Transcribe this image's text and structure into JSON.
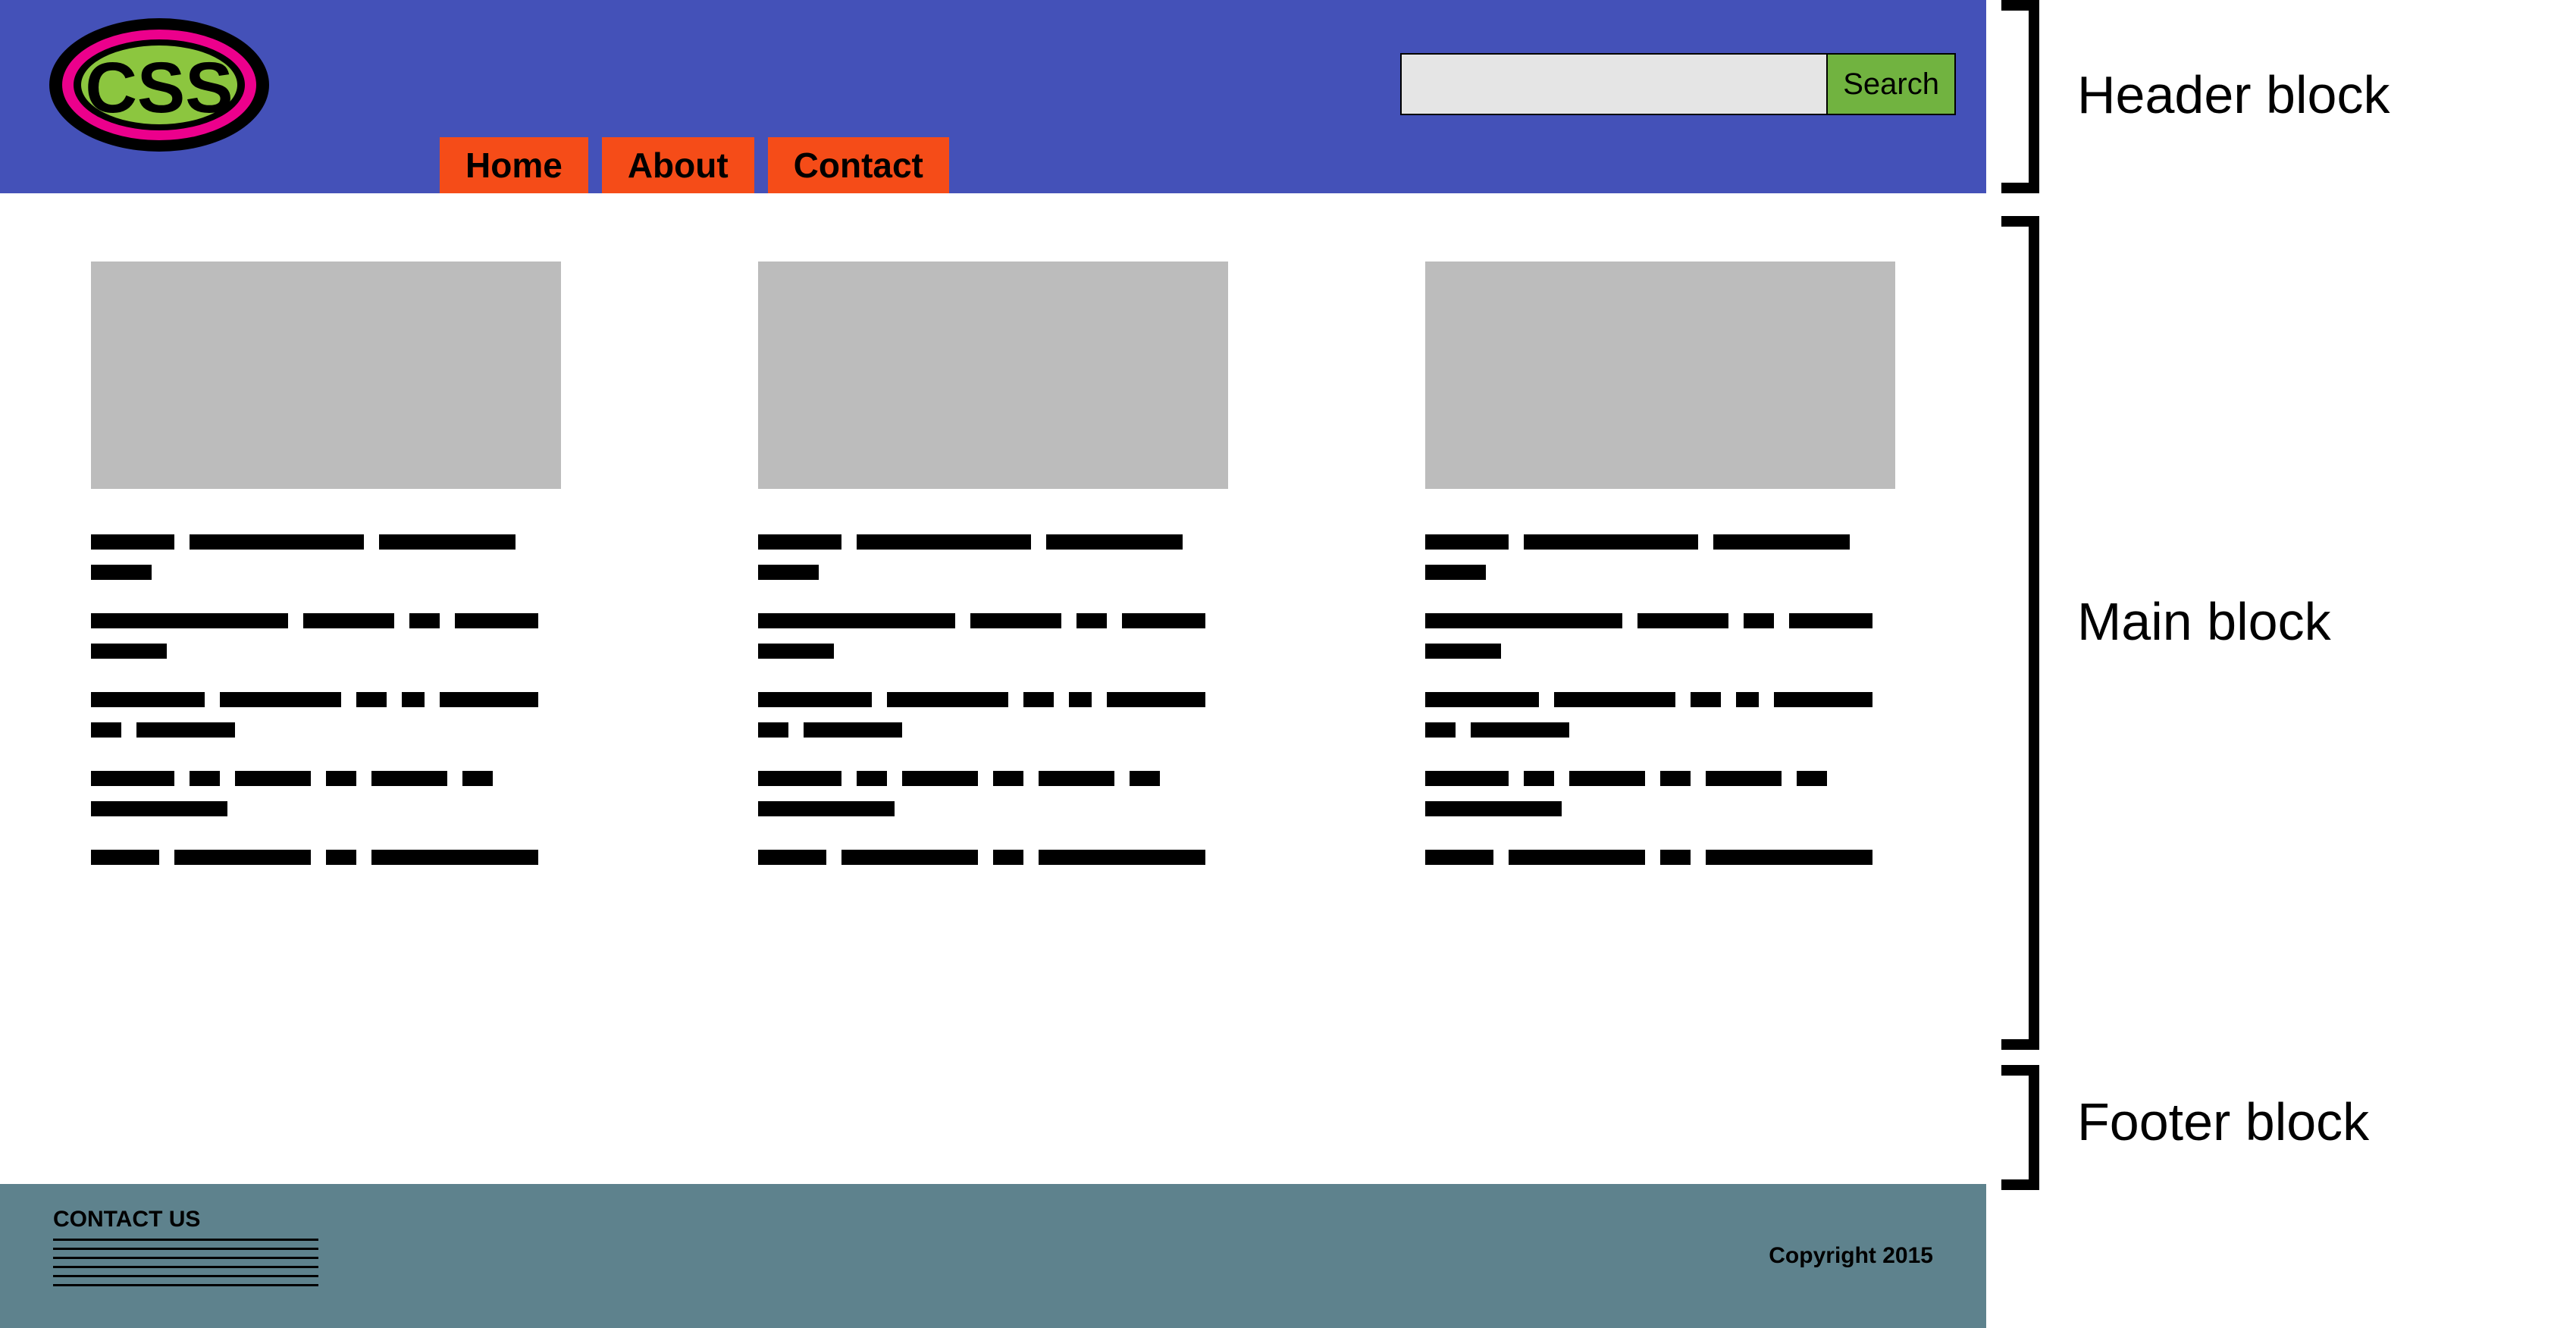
{
  "header": {
    "logo_text": "CSS",
    "nav": [
      "Home",
      "About",
      "Contact"
    ],
    "search_button": "Search"
  },
  "footer": {
    "contact_title": "CONTACT US",
    "copyright": "Copyright 2015"
  },
  "annotations": {
    "header_label": "Header block",
    "main_label": "Main block",
    "footer_label": "Footer block"
  },
  "colors": {
    "header_bg": "#4451b8",
    "nav_bg": "#f54c18",
    "search_btn_bg": "#71b340",
    "logo_inner": "#8cc63f",
    "logo_ring": "#ec008c",
    "footer_bg": "#5e828d",
    "placeholder": "#bcbcbc"
  }
}
